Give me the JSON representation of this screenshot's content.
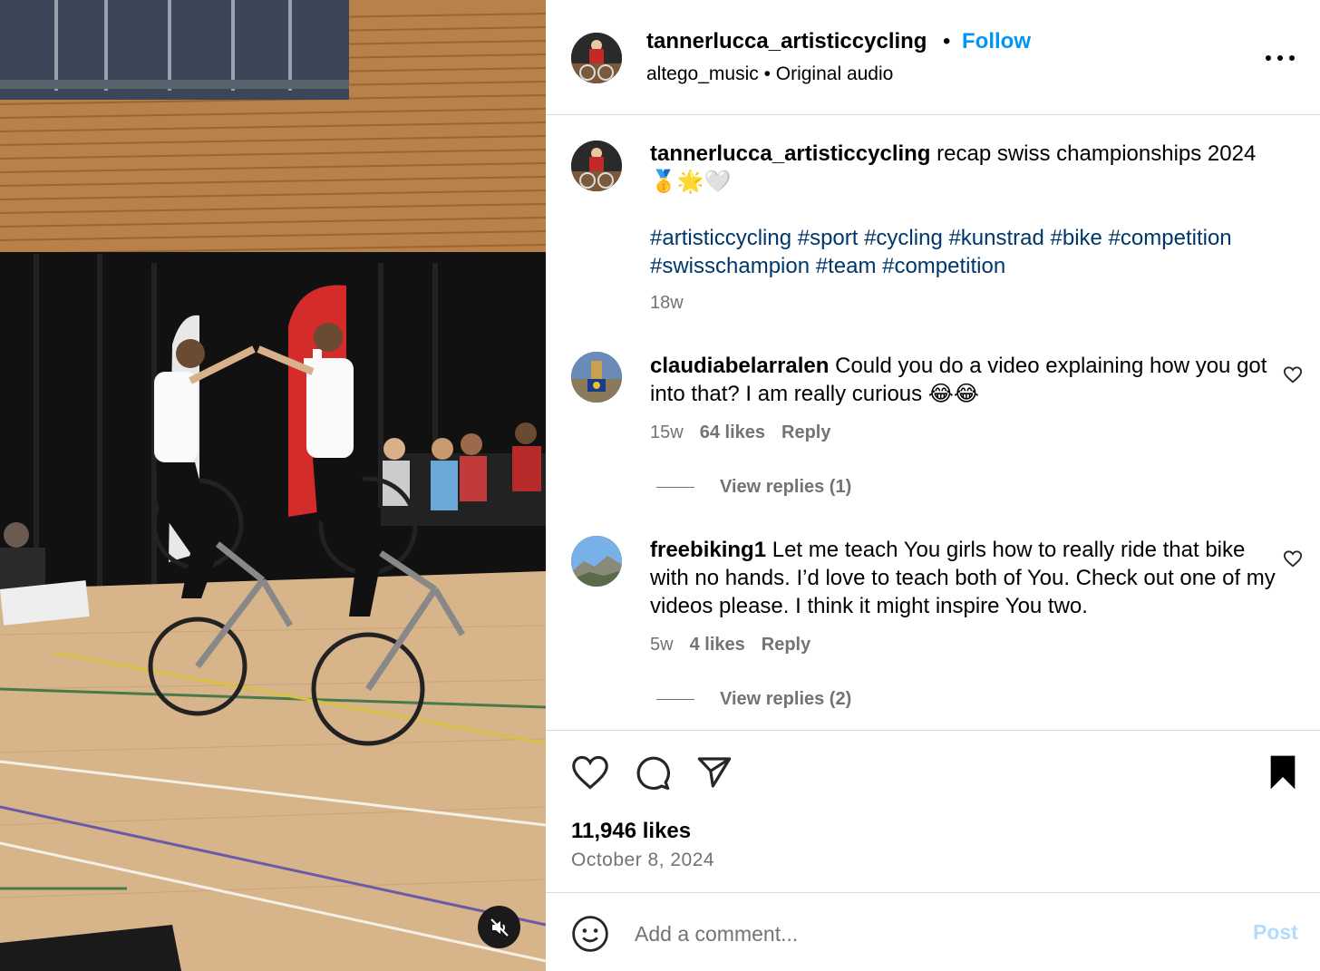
{
  "post": {
    "username": "tannerlucca_artisticcycling",
    "separator": "•",
    "follow_label": "Follow",
    "audio_line": "altego_music • Original audio"
  },
  "caption": {
    "username": "tannerlucca_artisticcycling",
    "text": " recap swiss championships 2024",
    "emojis": "🥇🌟🤍",
    "hashtags": "#artisticcycling #sport #cycling #kunstrad #bike #competition #swisschampion #team #competition",
    "age": "18w"
  },
  "comments": [
    {
      "username": "claudiabelarralen",
      "text": " Could you do a video explaining how you got into that? I am really curious 😂😂",
      "age": "15w",
      "likes": "64 likes",
      "reply_label": "Reply",
      "view_replies": "View replies (1)"
    },
    {
      "username": "freebiking1",
      "text": " Let me teach You girls how to really ride that bike with no hands. I’d love to teach both of You. Check out one of my videos please. I think it might inspire You two.",
      "age": "5w",
      "likes": "4 likes",
      "reply_label": "Reply",
      "view_replies": "View replies (2)"
    }
  ],
  "actions": {
    "likes": "11,946 likes",
    "date": "October 8, 2024"
  },
  "composer": {
    "placeholder": "Add a comment...",
    "post_label": "Post"
  },
  "icons": {
    "more": "more-options-icon",
    "like": "heart-icon",
    "comment": "comment-bubble-icon",
    "share": "paper-plane-icon",
    "save": "bookmark-icon",
    "emoji": "emoji-icon",
    "mute": "muted-speaker-icon"
  },
  "colors": {
    "accent": "#0095f6",
    "hashtag": "#00376b",
    "muted_text": "#737373",
    "post_disabled": "#b3dbff"
  }
}
